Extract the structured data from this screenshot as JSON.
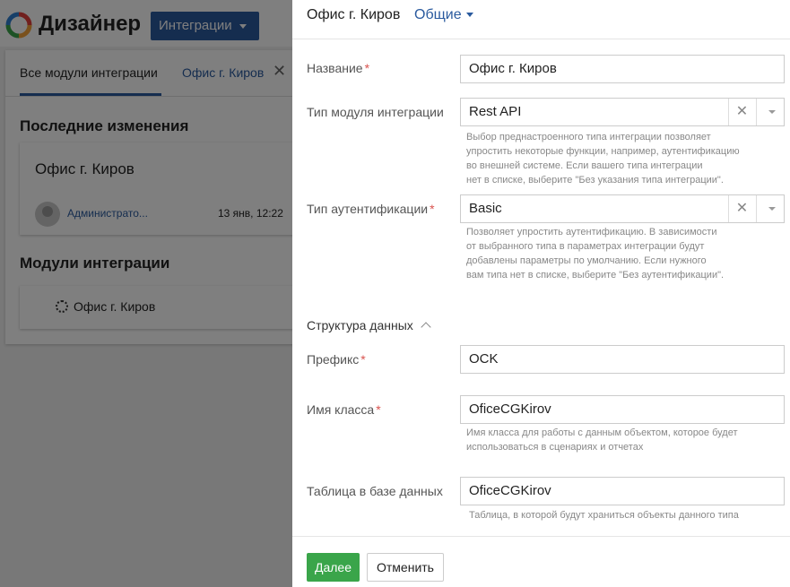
{
  "app": {
    "title": "Дизайнер",
    "menu_button": "Интеграции",
    "tabs": [
      {
        "label": "Все модули интеграции"
      },
      {
        "label": "Офис г. Киров"
      }
    ],
    "recent_title": "Последние изменения",
    "recent_card": {
      "title": "Офис г. Киров",
      "author": "Администрато...",
      "date": "13 янв, 12:22"
    },
    "modules_title": "Модули интеграции",
    "modules": [
      {
        "label": "Офис г. Киров"
      }
    ]
  },
  "panel": {
    "title": "Офис г. Киров",
    "section_link": "Общие",
    "fields": {
      "name": {
        "label": "Название",
        "value": "Офис г. Киров"
      },
      "module_type": {
        "label": "Тип модуля интеграции",
        "value": "Rest API",
        "hint": [
          "Выбор преднастроенного типа интеграции позволяет",
          "упростить некоторые функции, например, аутентификацию",
          "во внешней системе. Если вашего типа интеграции",
          "нет в списке, выберите \"Без указания типа интеграции\"."
        ]
      },
      "auth_type": {
        "label": "Тип аутентификации",
        "value": "Basic",
        "hint": [
          "Позволяет упростить аутентификацию. В зависимости",
          "от выбранного типа в параметрах интеграции будут",
          "добавлены параметры по умолчанию. Если нужного",
          "вам типа нет в списке, выберите \"Без аутентификации\"."
        ]
      },
      "structure_label": "Структура данных",
      "prefix": {
        "label": "Префикс",
        "value": "OCK"
      },
      "class_name": {
        "label": "Имя класса",
        "value": "OficeCGKirov",
        "hint": [
          "Имя класса для работы с данным объектом, которое будет",
          "использоваться в сценариях и отчетах"
        ]
      },
      "db_table": {
        "label": "Таблица в базе данных",
        "value": "OficeCGKirov",
        "hint": [
          "Таблица, в которой будут храниться объекты данного типа"
        ]
      }
    },
    "buttons": {
      "next": "Далее",
      "cancel": "Отменить"
    }
  },
  "colors": {
    "accent": "#2a5a9e",
    "primary_button": "#3aa54a",
    "required": "#d9534f"
  }
}
